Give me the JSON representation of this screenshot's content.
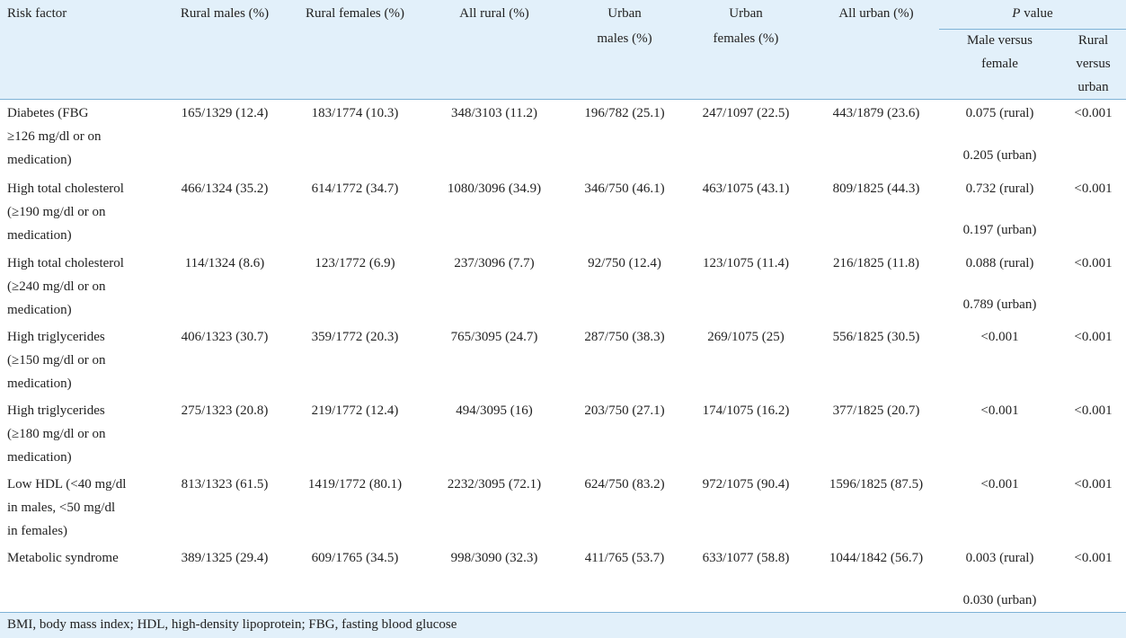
{
  "header": {
    "risk_factor": "Risk factor",
    "rural_males": "Rural males (%)",
    "rural_females": "Rural females (%)",
    "all_rural": "All rural (%)",
    "urban_males_1": "Urban",
    "urban_males_2": "males (%)",
    "urban_females_1": "Urban",
    "urban_females_2": "females (%)",
    "all_urban": "All urban (%)",
    "p_value_italic": "P",
    "p_value_rest": " value",
    "male_vs_female_1": "Male versus",
    "male_vs_female_2": "female",
    "rural_vs_urban_1": "Rural",
    "rural_vs_urban_2": "versus",
    "rural_vs_urban_3": "urban"
  },
  "rows": [
    {
      "label": [
        "Diabetes (FBG",
        "≥126 mg/dl or on",
        "medication)"
      ],
      "rural_males": "165/1329 (12.4)",
      "rural_females": "183/1774 (10.3)",
      "all_rural": "348/3103 (11.2)",
      "urban_males": "196/782 (25.1)",
      "urban_females": "247/1097 (22.5)",
      "all_urban": "443/1879 (23.6)",
      "p_mf_rural": "0.075 (rural)",
      "p_mf_urban": "0.205 (urban)",
      "p_ru": "<0.001"
    },
    {
      "label": [
        "High total cholesterol",
        "(≥190 mg/dl or on",
        "medication)"
      ],
      "rural_males": "466/1324 (35.2)",
      "rural_females": "614/1772 (34.7)",
      "all_rural": "1080/3096 (34.9)",
      "urban_males": "346/750 (46.1)",
      "urban_females": "463/1075 (43.1)",
      "all_urban": "809/1825 (44.3)",
      "p_mf_rural": "0.732 (rural)",
      "p_mf_urban": "0.197 (urban)",
      "p_ru": "<0.001"
    },
    {
      "label": [
        "High total cholesterol",
        "(≥240 mg/dl or on",
        "medication)"
      ],
      "rural_males": "114/1324 (8.6)",
      "rural_females": "123/1772 (6.9)",
      "all_rural": "237/3096 (7.7)",
      "urban_males": "92/750 (12.4)",
      "urban_females": "123/1075 (11.4)",
      "all_urban": "216/1825 (11.8)",
      "p_mf_rural": "0.088 (rural)",
      "p_mf_urban": "0.789 (urban)",
      "p_ru": "<0.001"
    },
    {
      "label": [
        "High triglycerides",
        "(≥150 mg/dl or on",
        "medication)"
      ],
      "rural_males": "406/1323 (30.7)",
      "rural_females": "359/1772 (20.3)",
      "all_rural": "765/3095 (24.7)",
      "urban_males": "287/750 (38.3)",
      "urban_females": "269/1075 (25)",
      "all_urban": "556/1825 (30.5)",
      "p_mf_rural": "<0.001",
      "p_mf_urban": "",
      "p_ru": "<0.001"
    },
    {
      "label": [
        "High triglycerides",
        "(≥180 mg/dl or on",
        "medication)"
      ],
      "rural_males": "275/1323 (20.8)",
      "rural_females": "219/1772 (12.4)",
      "all_rural": "494/3095 (16)",
      "urban_males": "203/750 (27.1)",
      "urban_females": "174/1075 (16.2)",
      "all_urban": "377/1825 (20.7)",
      "p_mf_rural": "<0.001",
      "p_mf_urban": "",
      "p_ru": "<0.001"
    },
    {
      "label": [
        "Low HDL (<40 mg/dl",
        "in males, <50 mg/dl",
        "in females)"
      ],
      "rural_males": "813/1323 (61.5)",
      "rural_females": "1419/1772 (80.1)",
      "all_rural": "2232/3095 (72.1)",
      "urban_males": "624/750 (83.2)",
      "urban_females": "972/1075 (90.4)",
      "all_urban": "1596/1825 (87.5)",
      "p_mf_rural": "<0.001",
      "p_mf_urban": "",
      "p_ru": "<0.001"
    },
    {
      "label": [
        "Metabolic syndrome",
        "",
        ""
      ],
      "rural_males": "389/1325 (29.4)",
      "rural_females": "609/1765 (34.5)",
      "all_rural": "998/3090 (32.3)",
      "urban_males": "411/765 (53.7)",
      "urban_females": "633/1077 (58.8)",
      "all_urban": "1044/1842 (56.7)",
      "p_mf_rural": "0.003 (rural)",
      "p_mf_urban": "0.030 (urban)",
      "p_ru": "<0.001"
    }
  ],
  "footnote": "BMI, body mass index; HDL, high-density lipoprotein; FBG, fasting blood glucose"
}
